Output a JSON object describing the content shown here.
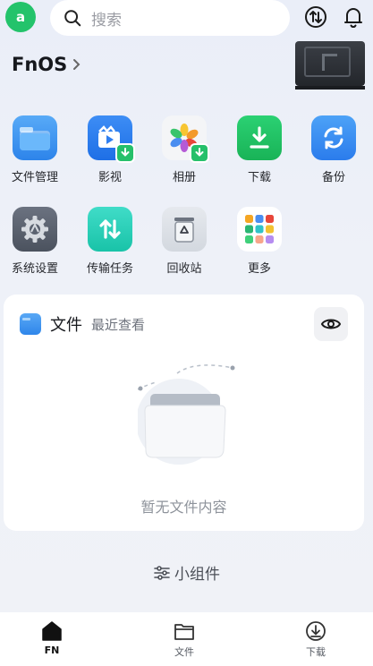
{
  "header": {
    "avatar_letter": "a",
    "search_placeholder": "搜索",
    "icons": [
      "transfer-icon",
      "bell-icon"
    ]
  },
  "device": {
    "name": "FnOS"
  },
  "apps": [
    {
      "label": "文件管理",
      "icon": "folder-icon",
      "color": "#3a95f0"
    },
    {
      "label": "影视",
      "icon": "video-icon",
      "color": "#2f7ff0"
    },
    {
      "label": "相册",
      "icon": "photos-icon",
      "color": "#f5f6f8"
    },
    {
      "label": "下载",
      "icon": "download-icon",
      "color": "#20c062"
    },
    {
      "label": "备份",
      "icon": "backup-icon",
      "color": "#3b8ff3"
    },
    {
      "label": "系统设置",
      "icon": "settings-icon",
      "color": "#5b6270"
    },
    {
      "label": "传输任务",
      "icon": "transfer-task-icon",
      "color": "#2bd1bd"
    },
    {
      "label": "回收站",
      "icon": "recycle-bin-icon",
      "color": "#dfe3e8"
    },
    {
      "label": "更多",
      "icon": "more-apps-icon",
      "color": "#ffffff"
    }
  ],
  "files_card": {
    "title": "文件",
    "subtitle": "最近查看",
    "empty_text": "暂无文件内容"
  },
  "widget": {
    "label": "小组件"
  },
  "bottom_nav": [
    {
      "label": "FN",
      "icon": "home-icon",
      "active": true
    },
    {
      "label": "文件",
      "icon": "folder-outline-icon",
      "active": false
    },
    {
      "label": "下载",
      "icon": "download-cloud-icon",
      "active": false
    }
  ],
  "colors": {
    "accent_green": "#23c36b",
    "background": "#eef1f8"
  }
}
